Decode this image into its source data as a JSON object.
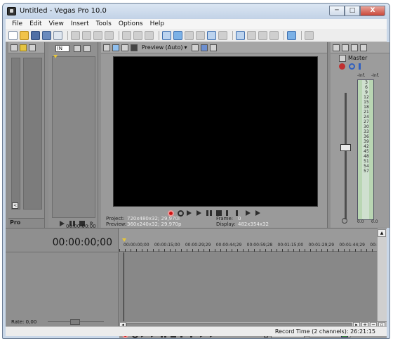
{
  "window": {
    "title": "Untitled - Vegas Pro 10.0",
    "min_label": "─",
    "max_label": "□",
    "close_label": "X"
  },
  "menu": [
    "File",
    "Edit",
    "View",
    "Insert",
    "Tools",
    "Options",
    "Help"
  ],
  "explorer": {
    "tab_label": "Pro",
    "checkbox_label": "<"
  },
  "trimmer": {
    "dropdown_value": "(N",
    "more_label": "»",
    "timecode": "00:00:00;00"
  },
  "preview": {
    "quality_label": "Preview (Auto)",
    "info": {
      "project_label": "Project:",
      "project_value": "720x480x32; 29,970i",
      "preview_label": "Preview:",
      "preview_value": "360x240x32; 29,970p",
      "frame_label": "Frame:",
      "frame_value": "0",
      "display_label": "Display:",
      "display_value": "482x354x32"
    }
  },
  "mixer": {
    "master_label": "Master",
    "left_peak": "-Inf.",
    "right_peak": "-Inf.",
    "scale": [
      "3",
      "6",
      "9",
      "12",
      "15",
      "18",
      "21",
      "24",
      "27",
      "30",
      "33",
      "36",
      "39",
      "42",
      "45",
      "48",
      "51",
      "54",
      "57"
    ],
    "left_level": "0.0",
    "right_level": "0.0"
  },
  "timeline": {
    "cursor_timecode": "00:00:00;00",
    "ruler_labels": [
      "00:00:00;00",
      "00:00:15;00",
      "00:00:29;29",
      "00:00:44;29",
      "00:00:59;28",
      "00:01:15;00",
      "00:01:29;29",
      "00:01:44;29",
      "00:"
    ],
    "rate_label": "Rate: 0,00",
    "bottom_timecode": "00:00:00;00"
  },
  "status": {
    "record_time": "Record Time (2 channels): 26:21:15"
  },
  "colors": {
    "record": "#cc1111",
    "marker": "#e6c63b",
    "screen": "#000000"
  }
}
